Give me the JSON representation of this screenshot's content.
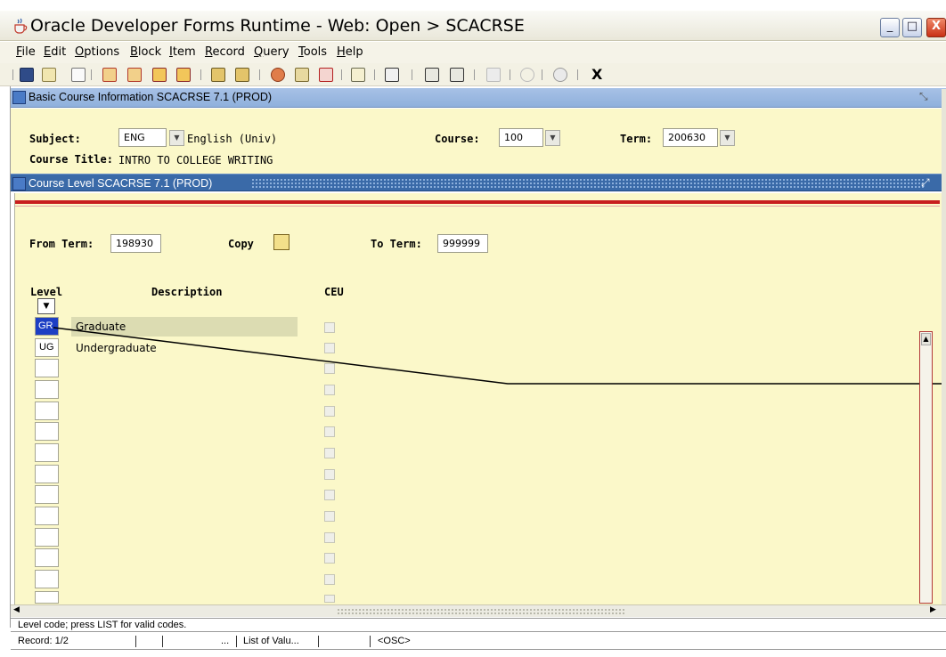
{
  "window": {
    "title": "Oracle Developer Forms Runtime - Web:  Open > SCACRSE",
    "minimize": "_",
    "maximize": "□",
    "close": "X"
  },
  "menu": [
    "File",
    "Edit",
    "Options",
    "Block",
    "Item",
    "Record",
    "Query",
    "Tools",
    "Help"
  ],
  "toolbar": {
    "exit_label": "X",
    "icons": [
      "save-icon",
      "rollback-icon",
      "select-icon",
      "insert-record-icon",
      "remove-record-icon",
      "previous-block-icon",
      "next-block-icon",
      "enter-query-icon",
      "execute-query-icon",
      "options-icon",
      "search-icon",
      "delete-icon",
      "attachment-icon",
      "print-icon",
      "help-item-icon",
      "help-form-icon",
      "sound-icon",
      "crosshair-icon",
      "question-icon",
      "exit-icon"
    ]
  },
  "basic_info": {
    "header": "Basic Course Information  SCACRSE  7.1  (PROD)",
    "subject_label": "Subject:",
    "subject_value": "ENG",
    "subject_desc": "English (Univ)",
    "course_label": "Course:",
    "course_value": "100",
    "term_label": "Term:",
    "term_value": "200630",
    "course_title_label": "Course Title:",
    "course_title_value": "INTRO TO COLLEGE WRITING"
  },
  "course_level": {
    "header": "Course Level  SCACRSE  7.1  (PROD)",
    "from_term_label": "From Term:",
    "from_term_value": "198930",
    "copy_label": "Copy",
    "to_term_label": "To Term:",
    "to_term_value": "999999",
    "col_level": "Level",
    "col_description": "Description",
    "col_ceu": "CEU",
    "rows": [
      {
        "level": "GR",
        "description": "Graduate"
      },
      {
        "level": "UG",
        "description": "Undergraduate"
      }
    ]
  },
  "status": {
    "message": "Level code; press LIST for valid codes.",
    "record": "Record: 1/2",
    "ellipsis": "...",
    "list_of_values": "List of Valu...",
    "osc": "<OSC>"
  },
  "colors": {
    "form_background": "#fbf8c9",
    "header_light": "#a7c1e6",
    "header_dark": "#3a6aa8",
    "accent_red": "#c81e1e",
    "selection": "#1d3fc4"
  }
}
